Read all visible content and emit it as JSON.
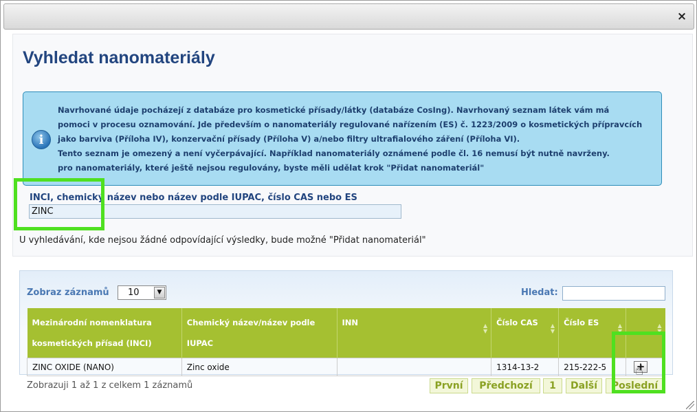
{
  "dialog": {
    "close_label": "×"
  },
  "page_title": "Vyhledat nanomateriály",
  "info": {
    "lines": [
      "Navrhované údaje pocházejí z databáze pro kosmetické přísady/látky (databáze CosIng). Navrhovaný seznam látek vám má",
      "pomoci v procesu oznamování. Jde především o nanomateriály regulované nařízením (ES) č. 1223/2009 o kosmetických přípravcích",
      "jako barviva (Příloha IV), konzervační přísady (Příloha V) a/nebo filtry ultrafialového záření (Příloha VI).",
      "Tento seznam je omezený a není vyčerpávající. Například nanomateriály oznámené podle čl. 16 nemusí být nutně navrženy.",
      "pro nanomateriály, které ještě nejsou regulovány, byste měli udělat krok \"Přidat nanomateriál\""
    ]
  },
  "search": {
    "label": "INCI, chemický název nebo název podle IUPAC, číslo CAS nebo ES",
    "value": "ZINC"
  },
  "hint": "U vyhledávání, kde nejsou žádné odpovídající výsledky, bude možné \"Přidat nanomateriál\"",
  "table": {
    "length_label": "Zobraz záznamů",
    "length_value": "10",
    "filter_label": "Hledat:",
    "filter_value": "",
    "columns": [
      "Mezinárodní nomenklatura kosmetických přísad (INCI)",
      "Chemický název/název podle IUPAC",
      "INN",
      "Číslo CAS",
      "Číslo ES",
      ""
    ],
    "rows": [
      {
        "inci": "ZINC OXIDE (NANO)",
        "chem": "Zinc oxide",
        "inn": "",
        "cas": "1314-13-2",
        "es": "215-222-5",
        "action": "+"
      }
    ],
    "info": "Zobrazuji 1 až 1 z celkem 1 záznamů",
    "pager": {
      "first": "První",
      "prev": "Předchozí",
      "page": "1",
      "next": "Další",
      "last": "Poslední"
    }
  }
}
